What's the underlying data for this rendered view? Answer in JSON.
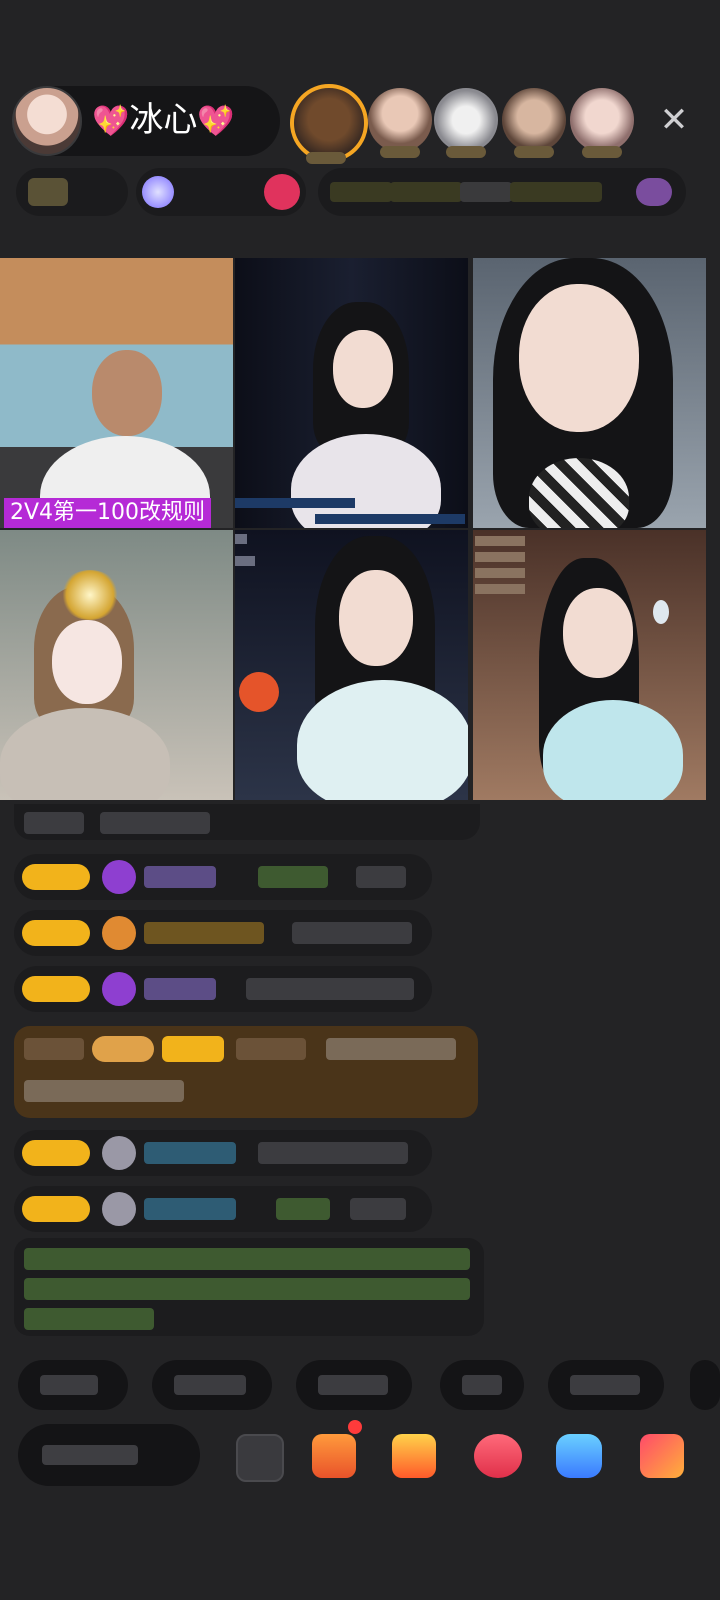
{
  "header": {
    "host_name": "冰心",
    "host_heart_left": "💖",
    "host_heart_right": "💖",
    "close_glyph": "✕",
    "viewer_avatars": [
      "viewer-1",
      "viewer-2",
      "viewer-3",
      "viewer-4",
      "viewer-5"
    ]
  },
  "video_grid": {
    "cell_1_caption": "2V4第一100改规则"
  },
  "colors": {
    "background": "#232325",
    "badge": "#f2b31b",
    "caption_bg": "#b52ad6"
  },
  "icons": [
    "gift-icon",
    "game-icon",
    "chat-icon",
    "share-icon",
    "more-icon",
    "panel-icon"
  ]
}
